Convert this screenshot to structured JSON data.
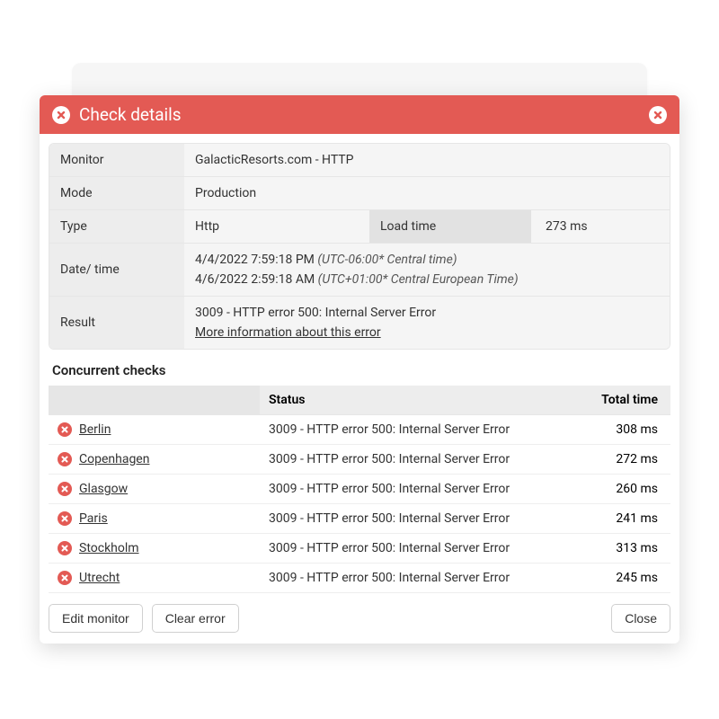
{
  "header": {
    "title": "Check details"
  },
  "details": {
    "monitor_label": "Monitor",
    "monitor_value": "GalacticResorts.com - HTTP",
    "mode_label": "Mode",
    "mode_value": "Production",
    "type_label": "Type",
    "type_value": "Http",
    "loadtime_label": "Load time",
    "loadtime_value": "273 ms",
    "datetime_label": "Date/ time",
    "datetime_1_main": "4/4/2022 7:59:18 PM",
    "datetime_1_tz": "(UTC-06:00* Central time)",
    "datetime_2_main": "4/6/2022 2:59:18 AM",
    "datetime_2_tz": "(UTC+01:00* Central European Time)",
    "result_label": "Result",
    "result_value": "3009 - HTTP error 500: Internal Server Error",
    "result_link": "More information about this error"
  },
  "concurrent": {
    "title": "Concurrent checks",
    "head_status": "Status",
    "head_time": "Total time",
    "rows": [
      {
        "location": "Berlin",
        "status": "3009 - HTTP error 500: Internal Server Error",
        "time": "308 ms"
      },
      {
        "location": "Copenhagen",
        "status": "3009 - HTTP error 500: Internal Server Error",
        "time": "272 ms"
      },
      {
        "location": "Glasgow",
        "status": "3009 - HTTP error 500: Internal Server Error",
        "time": "260 ms"
      },
      {
        "location": "Paris",
        "status": "3009 - HTTP error 500: Internal Server Error",
        "time": "241 ms"
      },
      {
        "location": "Stockholm",
        "status": "3009 - HTTP error 500: Internal Server Error",
        "time": "313 ms"
      },
      {
        "location": "Utrecht",
        "status": "3009 - HTTP error 500: Internal Server Error",
        "time": "245 ms"
      }
    ]
  },
  "footer": {
    "edit": "Edit monitor",
    "clear": "Clear error",
    "close": "Close"
  }
}
